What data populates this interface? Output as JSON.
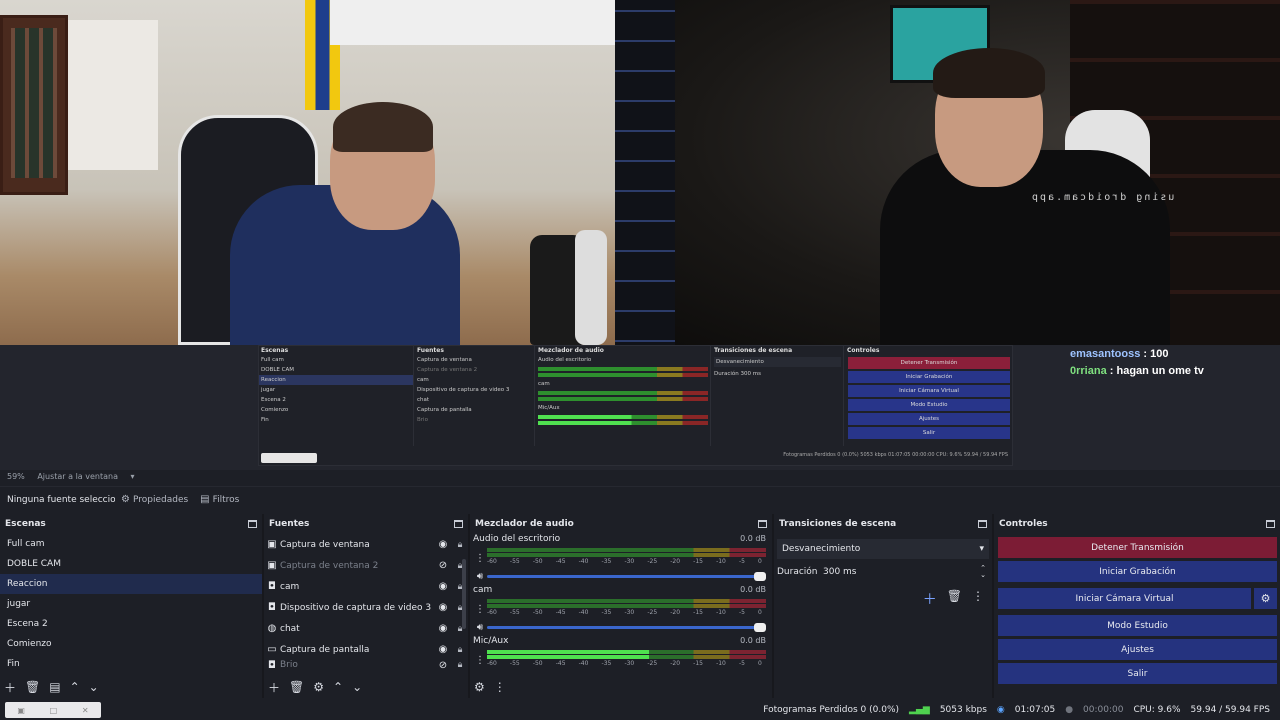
{
  "preview": {
    "watermark": "using droidcam.app",
    "chat": [
      {
        "user": "emasantooss",
        "message": "100"
      },
      {
        "user": "0rriana",
        "message": "hagan un ome tv"
      }
    ],
    "zoom_percent": "59%",
    "zoom_fit_label": "Ajustar a la ventana",
    "mini": {
      "scenes_title": "Escenas",
      "sources_title": "Fuentes",
      "mixer_title": "Mezclador de audio",
      "transitions_title": "Transiciones de escena",
      "controls_title": "Controles",
      "scenes": [
        "Full cam",
        "DOBLE CAM",
        "Reaccion",
        "jugar",
        "Escena 2",
        "Comienzo",
        "Fin"
      ],
      "sources": [
        "Captura de ventana",
        "Captura de ventana 2",
        "cam",
        "Dispositivo de captura de video 3",
        "chat",
        "Captura de pantalla",
        "Brio"
      ],
      "channels": [
        "Audio del escritorio",
        "cam",
        "Mic/Aux"
      ],
      "transition": "Desvanecimiento",
      "duration_label": "Duración",
      "duration": "300 ms",
      "controls": [
        "Detener Transmisión",
        "Iniciar Grabación",
        "Iniciar Cámara Virtual",
        "Modo Estudio",
        "Ajustes",
        "Salir"
      ],
      "status": "Fotogramas Perdidos 0 (0.0%)   5053 kbps   01:07:05   00:00:00   CPU: 9.6%   59.94 / 59.94 FPS"
    }
  },
  "source_toolbar": {
    "no_source": "Ninguna fuente seleccionada",
    "properties": "Propiedades",
    "filters": "Filtros"
  },
  "scenes": {
    "title": "Escenas",
    "items": [
      "Full cam",
      "DOBLE CAM",
      "Reaccion",
      "jugar",
      "Escena 2",
      "Comienzo",
      "Fin"
    ],
    "selected": "Reaccion"
  },
  "sources": {
    "title": "Fuentes",
    "items": [
      {
        "label": "Captura de ventana",
        "icon": "window-icon",
        "visible": true
      },
      {
        "label": "Captura de ventana 2",
        "icon": "window-icon",
        "visible": false
      },
      {
        "label": "cam",
        "icon": "camera-icon",
        "visible": true
      },
      {
        "label": "Dispositivo de captura de video 3",
        "icon": "camera-icon",
        "visible": true
      },
      {
        "label": "chat",
        "icon": "browser-icon",
        "visible": true
      },
      {
        "label": "Captura de pantalla",
        "icon": "monitor-icon",
        "visible": true
      },
      {
        "label": "Brio",
        "icon": "camera-icon",
        "visible": false
      }
    ]
  },
  "mixer": {
    "title": "Mezclador de audio",
    "ticks": [
      "-60",
      "-55",
      "-50",
      "-45",
      "-40",
      "-35",
      "-30",
      "-25",
      "-20",
      "-15",
      "-10",
      "-5",
      "0"
    ],
    "channels": [
      {
        "name": "Audio del escritorio",
        "db": "0.0 dB",
        "level": 0
      },
      {
        "name": "cam",
        "db": "0.0 dB",
        "level": 0
      },
      {
        "name": "Mic/Aux",
        "db": "0.0 dB",
        "level": 0.58
      }
    ]
  },
  "transitions": {
    "title": "Transiciones de escena",
    "selected": "Desvanecimiento",
    "duration_label": "Duración",
    "duration": "300 ms"
  },
  "controls": {
    "title": "Controles",
    "stop_stream": "Detener Transmisión",
    "start_recording": "Iniciar Grabación",
    "start_virtual_cam": "Iniciar Cámara Virtual",
    "studio_mode": "Modo Estudio",
    "settings": "Ajustes",
    "exit": "Salir"
  },
  "statusbar": {
    "dropped_frames": "Fotogramas Perdidos 0 (0.0%)",
    "bitrate": "5053 kbps",
    "stream_time": "01:07:05",
    "rec_time": "00:00:00",
    "cpu": "CPU: 9.6%",
    "fps": "59.94 / 59.94 FPS"
  },
  "colors": {
    "background": "#1d1f26",
    "selected": "#202b4d",
    "button": "#25337f",
    "stop_button": "#7c1c35",
    "fader": "#3a66cc"
  }
}
